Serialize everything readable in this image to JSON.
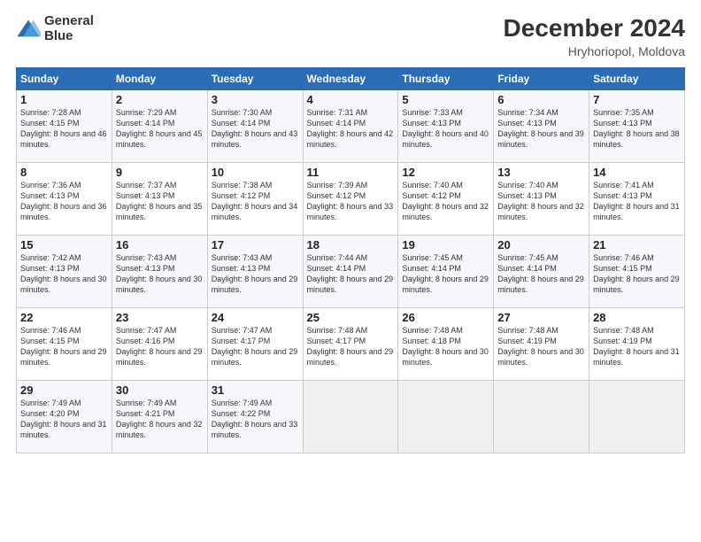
{
  "header": {
    "logo_line1": "General",
    "logo_line2": "Blue",
    "month": "December 2024",
    "location": "Hryhoriopol, Moldova"
  },
  "weekdays": [
    "Sunday",
    "Monday",
    "Tuesday",
    "Wednesday",
    "Thursday",
    "Friday",
    "Saturday"
  ],
  "weeks": [
    [
      {
        "day": "1",
        "sunrise": "Sunrise: 7:28 AM",
        "sunset": "Sunset: 4:15 PM",
        "daylight": "Daylight: 8 hours and 46 minutes."
      },
      {
        "day": "2",
        "sunrise": "Sunrise: 7:29 AM",
        "sunset": "Sunset: 4:14 PM",
        "daylight": "Daylight: 8 hours and 45 minutes."
      },
      {
        "day": "3",
        "sunrise": "Sunrise: 7:30 AM",
        "sunset": "Sunset: 4:14 PM",
        "daylight": "Daylight: 8 hours and 43 minutes."
      },
      {
        "day": "4",
        "sunrise": "Sunrise: 7:31 AM",
        "sunset": "Sunset: 4:14 PM",
        "daylight": "Daylight: 8 hours and 42 minutes."
      },
      {
        "day": "5",
        "sunrise": "Sunrise: 7:33 AM",
        "sunset": "Sunset: 4:13 PM",
        "daylight": "Daylight: 8 hours and 40 minutes."
      },
      {
        "day": "6",
        "sunrise": "Sunrise: 7:34 AM",
        "sunset": "Sunset: 4:13 PM",
        "daylight": "Daylight: 8 hours and 39 minutes."
      },
      {
        "day": "7",
        "sunrise": "Sunrise: 7:35 AM",
        "sunset": "Sunset: 4:13 PM",
        "daylight": "Daylight: 8 hours and 38 minutes."
      }
    ],
    [
      {
        "day": "8",
        "sunrise": "Sunrise: 7:36 AM",
        "sunset": "Sunset: 4:13 PM",
        "daylight": "Daylight: 8 hours and 36 minutes."
      },
      {
        "day": "9",
        "sunrise": "Sunrise: 7:37 AM",
        "sunset": "Sunset: 4:13 PM",
        "daylight": "Daylight: 8 hours and 35 minutes."
      },
      {
        "day": "10",
        "sunrise": "Sunrise: 7:38 AM",
        "sunset": "Sunset: 4:12 PM",
        "daylight": "Daylight: 8 hours and 34 minutes."
      },
      {
        "day": "11",
        "sunrise": "Sunrise: 7:39 AM",
        "sunset": "Sunset: 4:12 PM",
        "daylight": "Daylight: 8 hours and 33 minutes."
      },
      {
        "day": "12",
        "sunrise": "Sunrise: 7:40 AM",
        "sunset": "Sunset: 4:12 PM",
        "daylight": "Daylight: 8 hours and 32 minutes."
      },
      {
        "day": "13",
        "sunrise": "Sunrise: 7:40 AM",
        "sunset": "Sunset: 4:13 PM",
        "daylight": "Daylight: 8 hours and 32 minutes."
      },
      {
        "day": "14",
        "sunrise": "Sunrise: 7:41 AM",
        "sunset": "Sunset: 4:13 PM",
        "daylight": "Daylight: 8 hours and 31 minutes."
      }
    ],
    [
      {
        "day": "15",
        "sunrise": "Sunrise: 7:42 AM",
        "sunset": "Sunset: 4:13 PM",
        "daylight": "Daylight: 8 hours and 30 minutes."
      },
      {
        "day": "16",
        "sunrise": "Sunrise: 7:43 AM",
        "sunset": "Sunset: 4:13 PM",
        "daylight": "Daylight: 8 hours and 30 minutes."
      },
      {
        "day": "17",
        "sunrise": "Sunrise: 7:43 AM",
        "sunset": "Sunset: 4:13 PM",
        "daylight": "Daylight: 8 hours and 29 minutes."
      },
      {
        "day": "18",
        "sunrise": "Sunrise: 7:44 AM",
        "sunset": "Sunset: 4:14 PM",
        "daylight": "Daylight: 8 hours and 29 minutes."
      },
      {
        "day": "19",
        "sunrise": "Sunrise: 7:45 AM",
        "sunset": "Sunset: 4:14 PM",
        "daylight": "Daylight: 8 hours and 29 minutes."
      },
      {
        "day": "20",
        "sunrise": "Sunrise: 7:45 AM",
        "sunset": "Sunset: 4:14 PM",
        "daylight": "Daylight: 8 hours and 29 minutes."
      },
      {
        "day": "21",
        "sunrise": "Sunrise: 7:46 AM",
        "sunset": "Sunset: 4:15 PM",
        "daylight": "Daylight: 8 hours and 29 minutes."
      }
    ],
    [
      {
        "day": "22",
        "sunrise": "Sunrise: 7:46 AM",
        "sunset": "Sunset: 4:15 PM",
        "daylight": "Daylight: 8 hours and 29 minutes."
      },
      {
        "day": "23",
        "sunrise": "Sunrise: 7:47 AM",
        "sunset": "Sunset: 4:16 PM",
        "daylight": "Daylight: 8 hours and 29 minutes."
      },
      {
        "day": "24",
        "sunrise": "Sunrise: 7:47 AM",
        "sunset": "Sunset: 4:17 PM",
        "daylight": "Daylight: 8 hours and 29 minutes."
      },
      {
        "day": "25",
        "sunrise": "Sunrise: 7:48 AM",
        "sunset": "Sunset: 4:17 PM",
        "daylight": "Daylight: 8 hours and 29 minutes."
      },
      {
        "day": "26",
        "sunrise": "Sunrise: 7:48 AM",
        "sunset": "Sunset: 4:18 PM",
        "daylight": "Daylight: 8 hours and 30 minutes."
      },
      {
        "day": "27",
        "sunrise": "Sunrise: 7:48 AM",
        "sunset": "Sunset: 4:19 PM",
        "daylight": "Daylight: 8 hours and 30 minutes."
      },
      {
        "day": "28",
        "sunrise": "Sunrise: 7:48 AM",
        "sunset": "Sunset: 4:19 PM",
        "daylight": "Daylight: 8 hours and 31 minutes."
      }
    ],
    [
      {
        "day": "29",
        "sunrise": "Sunrise: 7:49 AM",
        "sunset": "Sunset: 4:20 PM",
        "daylight": "Daylight: 8 hours and 31 minutes."
      },
      {
        "day": "30",
        "sunrise": "Sunrise: 7:49 AM",
        "sunset": "Sunset: 4:21 PM",
        "daylight": "Daylight: 8 hours and 32 minutes."
      },
      {
        "day": "31",
        "sunrise": "Sunrise: 7:49 AM",
        "sunset": "Sunset: 4:22 PM",
        "daylight": "Daylight: 8 hours and 33 minutes."
      },
      null,
      null,
      null,
      null
    ]
  ]
}
